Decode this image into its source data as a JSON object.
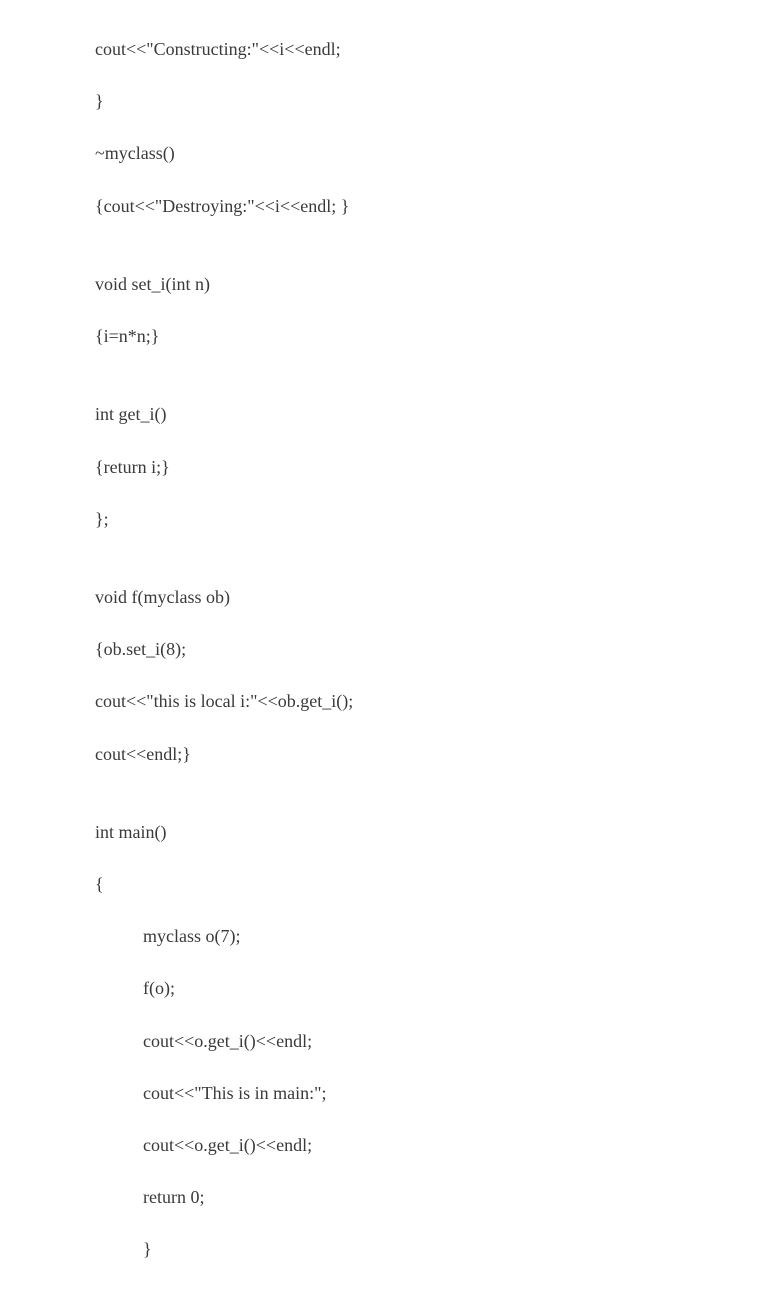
{
  "code": {
    "l1": "cout<<\"Constructing:\"<<i<<endl;",
    "l2": "}",
    "l3": "~myclass()",
    "l4": "{cout<<\"Destroying:\"<<i<<endl; }",
    "l5": "",
    "l6": "void set_i(int n)",
    "l7": "{i=n*n;}",
    "l8": "",
    "l9": "int get_i()",
    "l10": "{return i;}",
    "l11": "};",
    "l12": "",
    "l13": "void f(myclass ob)",
    "l14": "{ob.set_i(8);",
    "l15": "cout<<\"this is local i:\"<<ob.get_i();",
    "l16": "cout<<endl;}",
    "l17": "",
    "l18": "int main()",
    "l19": "{",
    "l20": "myclass o(7);",
    "l21": "f(o);",
    "l22": "cout<<o.get_i()<<endl;",
    "l23": "cout<<\"This is in main:\";",
    "l24": "cout<<o.get_i()<<endl;",
    "l25": "return 0;",
    "l26": "}"
  }
}
